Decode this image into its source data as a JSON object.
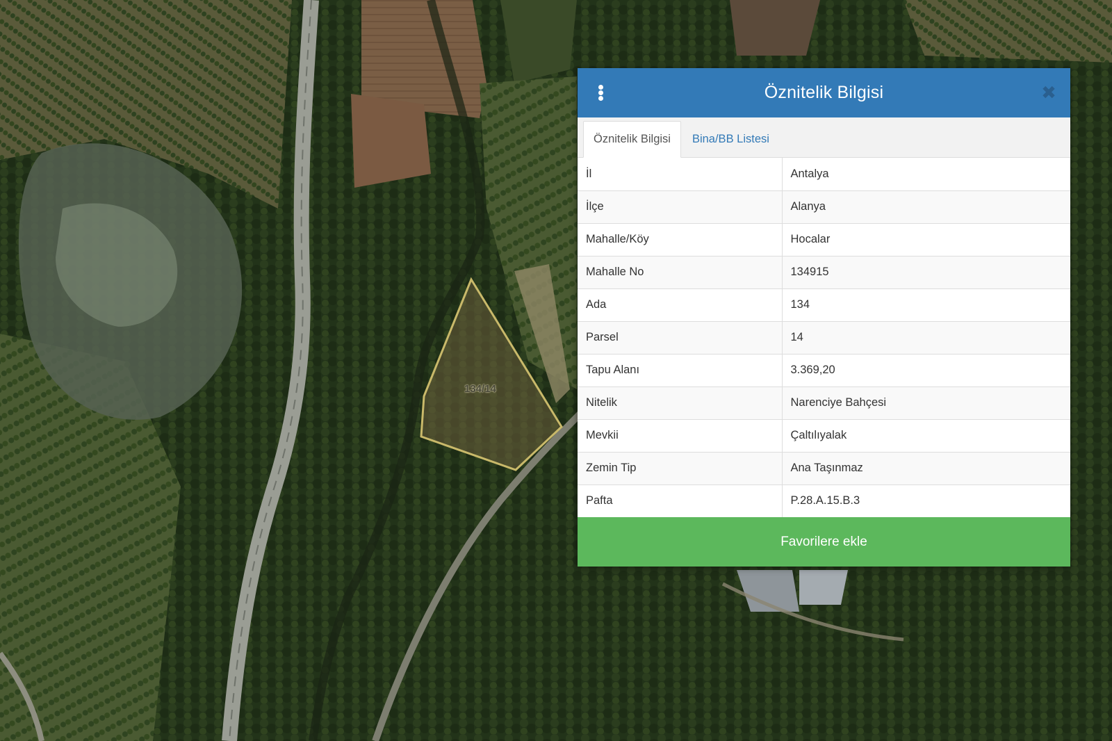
{
  "map": {
    "parcel_label": "134/14"
  },
  "panel": {
    "title": "Öznitelik Bilgisi",
    "tabs": [
      {
        "label": "Öznitelik Bilgisi",
        "active": true
      },
      {
        "label": "Bina/BB Listesi",
        "active": false
      }
    ],
    "rows": [
      {
        "key": "İl",
        "value": "Antalya"
      },
      {
        "key": "İlçe",
        "value": "Alanya"
      },
      {
        "key": "Mahalle/Köy",
        "value": "Hocalar"
      },
      {
        "key": "Mahalle No",
        "value": "134915"
      },
      {
        "key": "Ada",
        "value": "134"
      },
      {
        "key": "Parsel",
        "value": "14"
      },
      {
        "key": "Tapu Alanı",
        "value": "3.369,20"
      },
      {
        "key": "Nitelik",
        "value": "Narenciye Bahçesi"
      },
      {
        "key": "Mevkii",
        "value": "Çaltılıyalak"
      },
      {
        "key": "Zemin Tip",
        "value": "Ana Taşınmaz"
      },
      {
        "key": "Pafta",
        "value": "P.28.A.15.B.3"
      }
    ],
    "favorite_button": "Favorilere ekle"
  },
  "icons": {
    "menu": "vertical-ellipsis-icon",
    "close": "close-icon"
  },
  "colors": {
    "header": "#337ab7",
    "favorite_button": "#5cb85c",
    "parcel_outline": "#c9b96a"
  }
}
